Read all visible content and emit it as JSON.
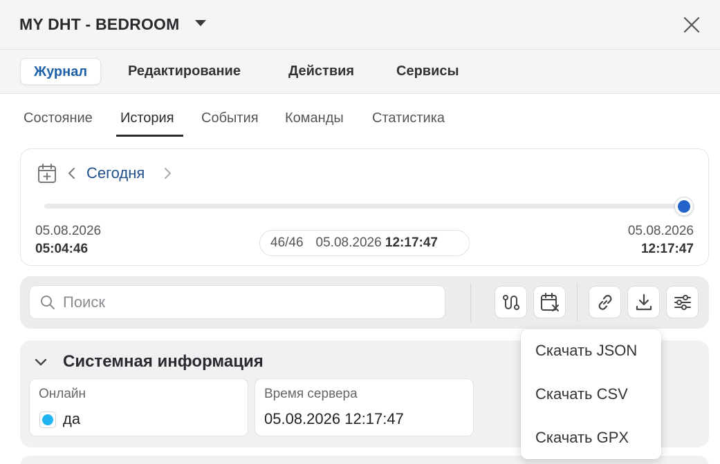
{
  "header": {
    "title": "MY DHT - BEDROOM"
  },
  "main_tabs": [
    {
      "label": "Журнал",
      "active": true
    },
    {
      "label": "Редактирование"
    },
    {
      "label": "Действия"
    },
    {
      "label": "Сервисы"
    }
  ],
  "sub_tabs": [
    {
      "label": "Состояние"
    },
    {
      "label": "История",
      "active": true
    },
    {
      "label": "События"
    },
    {
      "label": "Команды"
    },
    {
      "label": "Статистика"
    }
  ],
  "date_nav": {
    "label": "Сегодня",
    "slider_position": 1.0,
    "start_date": "05.08.2026",
    "start_time": "05:04:46",
    "end_date": "05.08.2026",
    "end_time": "12:17:47",
    "current_count": "46/46",
    "current_date": "05.08.2026",
    "current_time": "12:17:47"
  },
  "search": {
    "placeholder": "Поиск",
    "value": ""
  },
  "toolbar_icons": [
    "route-icon",
    "calendar-clear-icon",
    "link-icon",
    "download-icon",
    "filter-settings-icon"
  ],
  "section": {
    "title": "Системная информация",
    "fields": [
      {
        "label": "Онлайн",
        "value": "да",
        "status_color": "#20b4f0"
      },
      {
        "label": "Время сервера",
        "value": "05.08.2026 12:17:47"
      }
    ]
  },
  "download_menu": {
    "items": [
      "Скачать JSON",
      "Скачать CSV",
      "Скачать GPX"
    ]
  },
  "colors": {
    "accent": "#1d5fa8",
    "slider": "#2563c9",
    "online": "#20b4f0"
  }
}
